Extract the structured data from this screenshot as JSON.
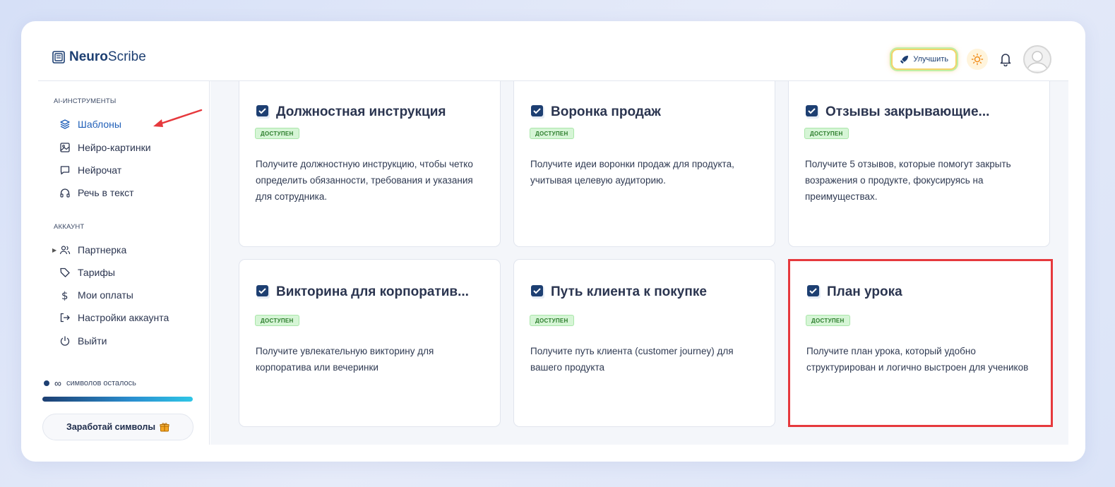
{
  "app": {
    "logo_bold": "Neuro",
    "logo_rest": "Scribe"
  },
  "header": {
    "upgrade_label": "Улучшить"
  },
  "sidebar": {
    "section_tools": "AI-ИНСТРУМЕНТЫ",
    "tools": [
      {
        "label": "Шаблоны",
        "icon": "layers-icon",
        "active": true
      },
      {
        "label": "Нейро-картинки",
        "icon": "image-icon"
      },
      {
        "label": "Нейрочат",
        "icon": "chat-icon"
      },
      {
        "label": "Речь в текст",
        "icon": "headphones-icon"
      }
    ],
    "section_account": "АККАУНТ",
    "account": [
      {
        "label": "Партнерка",
        "icon": "users-icon"
      },
      {
        "label": "Тарифы",
        "icon": "tag-icon"
      },
      {
        "label": "Мои оплаты",
        "icon": "dollar-icon"
      },
      {
        "label": "Настройки аккаунта",
        "icon": "login-icon"
      },
      {
        "label": "Выйти",
        "icon": "power-icon"
      }
    ],
    "symbols_text": "символов осталось",
    "symbols_value": "∞",
    "earn_label": "Заработай символы"
  },
  "cards": [
    {
      "title": "Должностная инструкция",
      "badge": "ДОСТУПЕН",
      "desc": "Получите должностную инструкцию, чтобы четко определить обязанности, требования и указания для сотрудника."
    },
    {
      "title": "Воронка продаж",
      "badge": "ДОСТУПЕН",
      "desc": "Получите идеи воронки продаж для продукта, учитывая целевую аудиторию."
    },
    {
      "title": "Отзывы закрывающие...",
      "badge": "ДОСТУПЕН",
      "desc": "Получите 5 отзывов, которые помогут закрыть возражения о продукте, фокусируясь на преимуществах."
    },
    {
      "title": "Викторина для корпоратив...",
      "badge": "ДОСТУПЕН",
      "desc": "Получите увлекательную викторину для корпоратива или вечеринки"
    },
    {
      "title": "Путь клиента к покупке",
      "badge": "ДОСТУПЕН",
      "desc": "Получите путь клиента (customer journey) для вашего продукта"
    },
    {
      "title": "План урока",
      "badge": "ДОСТУПЕН",
      "desc": "Получите план урока, который удобно структурирован и логично выстроен для учеников",
      "highlighted": true
    }
  ],
  "colors": {
    "accent": "#1f5fb8",
    "highlight": "#e6393d",
    "badge_bg": "#d6f5d6"
  }
}
